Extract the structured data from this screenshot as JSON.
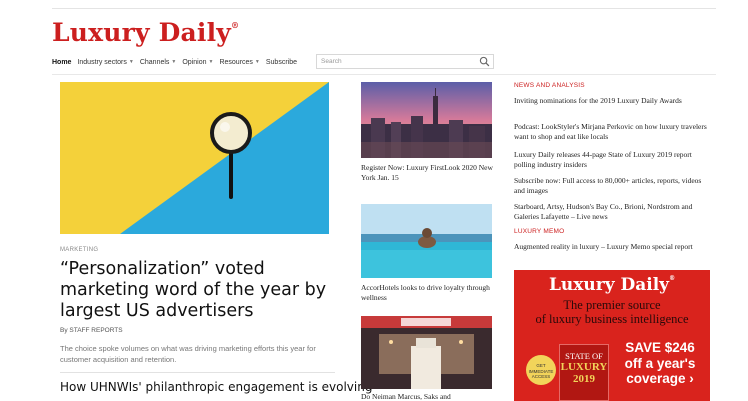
{
  "logo": {
    "text": "Luxury Daily",
    "mark": "®"
  },
  "nav": {
    "items": [
      {
        "label": "Home",
        "caret": false,
        "active": true
      },
      {
        "label": "Industry sectors",
        "caret": true
      },
      {
        "label": "Channels",
        "caret": true
      },
      {
        "label": "Opinion",
        "caret": true
      },
      {
        "label": "Resources",
        "caret": true
      },
      {
        "label": "Subscribe",
        "caret": false
      }
    ],
    "search_placeholder": "Search"
  },
  "hero": {
    "category": "MARKETING",
    "title": "“Personalization” voted marketing word of the year by largest US advertisers",
    "byline": "By STAFF REPORTS",
    "description": "The choice spoke volumes on what was driving marketing efforts this year for customer acquisition and retention.",
    "next_title": "How UHNWIs' philanthropic engagement is evolving"
  },
  "middle": [
    {
      "caption": "Register Now: Luxury FirstLook 2020 New York Jan. 15"
    },
    {
      "caption": "AccorHotels looks to drive loyalty through wellness"
    },
    {
      "caption": "Do Neiman Marcus, Saks and"
    }
  ],
  "news": {
    "heading": "NEWS AND ANALYSIS",
    "items": [
      "Inviting nominations for the 2019 Luxury Daily Awards",
      "Podcast: LookStyler's Mirjana Perkovic on how luxury travelers want to shop and eat like locals",
      "Luxury Daily releases 44-page State of Luxury 2019 report polling industry insiders",
      "Subscribe now: Full access to 80,000+ articles, reports, videos and images",
      "Starboard, Artsy, Hudson's Bay Co., Brioni, Nordstrom and Galeries Lafayette – Live news"
    ]
  },
  "memo": {
    "heading": "LUXURY MEMO",
    "items": [
      "Augmented reality in luxury – Luxury Memo special report"
    ]
  },
  "ad": {
    "logo": "Luxury Daily",
    "mark": "®",
    "tagline_1": "The premier source",
    "tagline_2": "of luxury business intelligence",
    "badge": "GET IMMEDIATE ACCESS",
    "book_l1": "STATE OF",
    "book_l2": "LUXURY",
    "book_l3": "2019",
    "save_1": "SAVE $246",
    "save_2": "off a year's",
    "save_3": "coverage ›"
  },
  "colors": {
    "brand_red": "#cc1f1f",
    "ad_red": "#d9231d"
  }
}
